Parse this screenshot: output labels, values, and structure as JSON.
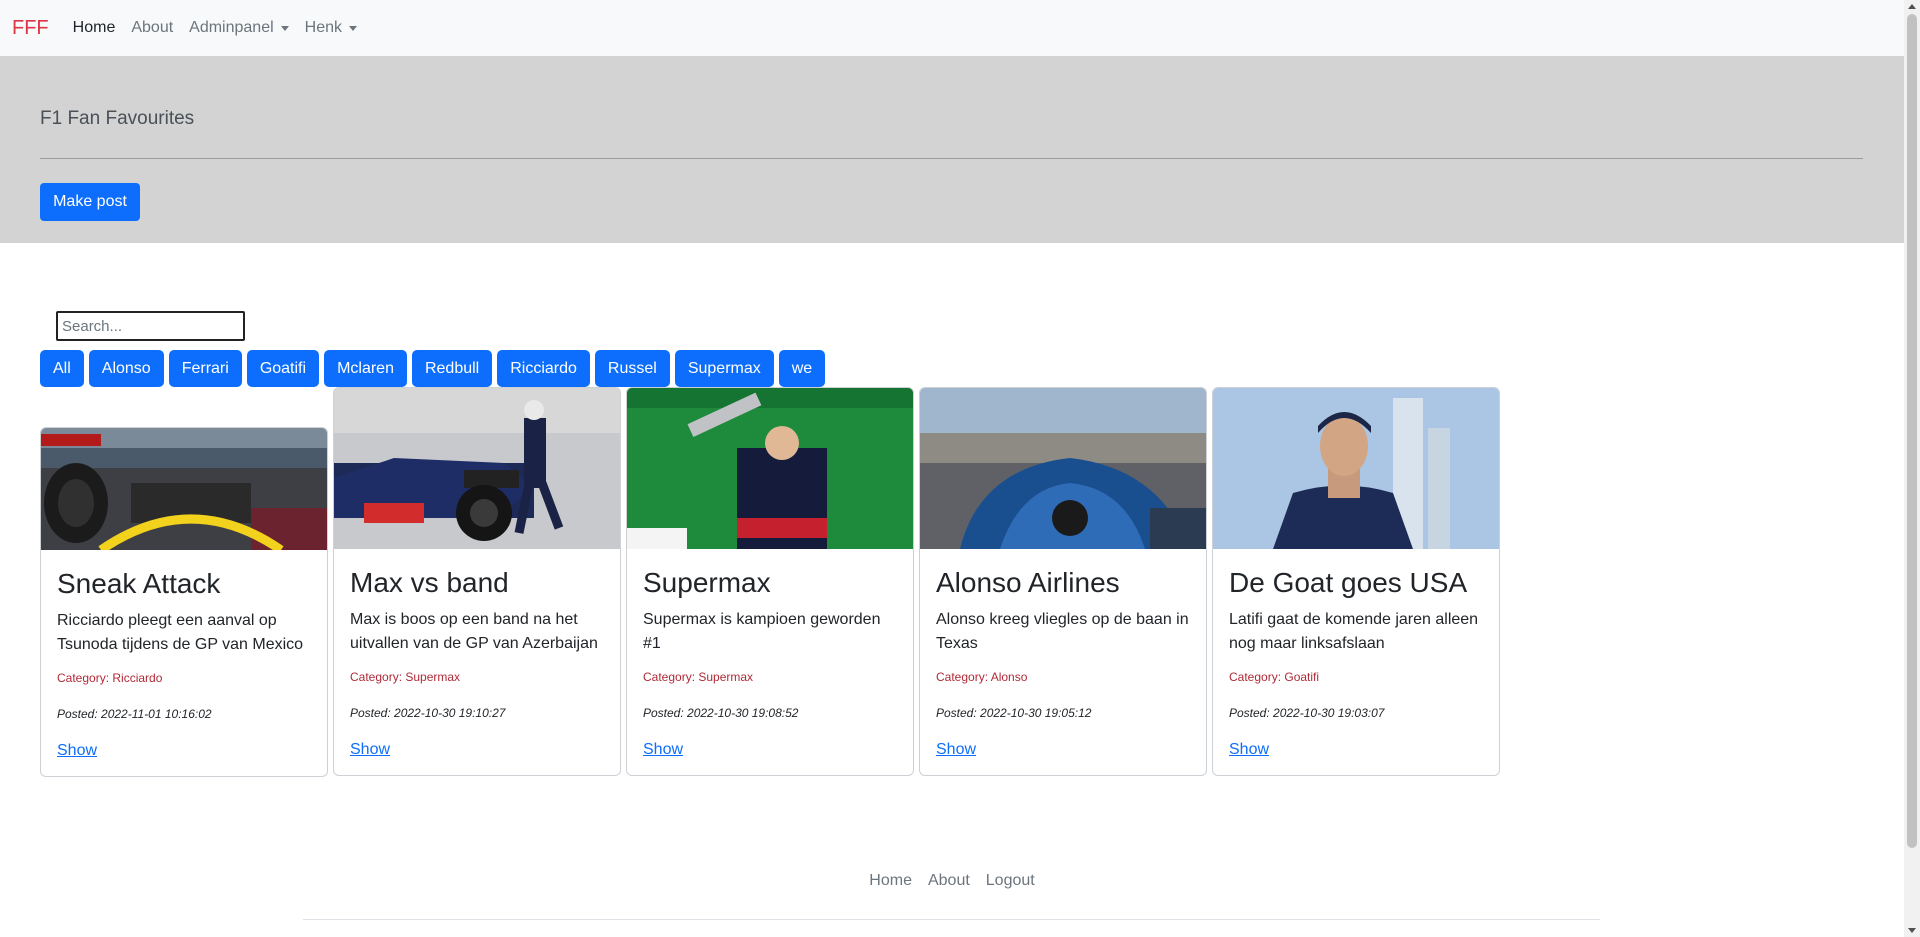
{
  "navbar": {
    "brand": "FFF",
    "items": [
      {
        "label": "Home",
        "active": true
      },
      {
        "label": "About",
        "active": false
      },
      {
        "label": "Adminpanel",
        "dropdown": true
      },
      {
        "label": "Henk",
        "dropdown": true
      }
    ]
  },
  "hero": {
    "title": "F1 Fan Favourites",
    "make_post_label": "Make post"
  },
  "search": {
    "placeholder": "Search...",
    "value": ""
  },
  "filters": [
    "All",
    "Alonso",
    "Ferrari",
    "Goatifi",
    "Mclaren",
    "Redbull",
    "Ricciardo",
    "Russel",
    "Supermax",
    "we"
  ],
  "posts": [
    {
      "title": "Sneak Attack",
      "text": "Ricciardo pleegt een aanval op Tsunoda tijdens de GP van Mexico",
      "category": "Category: Ricciardo",
      "posted": "Posted: 2022-11-01 10:16:02",
      "link": "Show"
    },
    {
      "title": "Max vs band",
      "text": "Max is boos op een band na het uitvallen van de GP van Azerbaijan",
      "category": "Category: Supermax",
      "posted": "Posted: 2022-10-30 19:10:27",
      "link": "Show"
    },
    {
      "title": "Supermax",
      "text": "Supermax is kampioen geworden #1",
      "category": "Category: Supermax",
      "posted": "Posted: 2022-10-30 19:08:52",
      "link": "Show"
    },
    {
      "title": "Alonso Airlines",
      "text": "Alonso kreeg vliegles op de baan in Texas",
      "category": "Category: Alonso",
      "posted": "Posted: 2022-10-30 19:05:12",
      "link": "Show"
    },
    {
      "title": "De Goat goes USA",
      "text": "Latifi gaat de komende jaren alleen nog maar linksafslaan",
      "category": "Category: Goatifi",
      "posted": "Posted: 2022-10-30 19:03:07",
      "link": "Show"
    }
  ],
  "footer": {
    "links": [
      "Home",
      "About",
      "Logout"
    ]
  },
  "colors": {
    "brand": "#dc3545",
    "primary": "#0d6efd",
    "hero_bg": "#d3d3d3",
    "category": "#b02a37"
  }
}
